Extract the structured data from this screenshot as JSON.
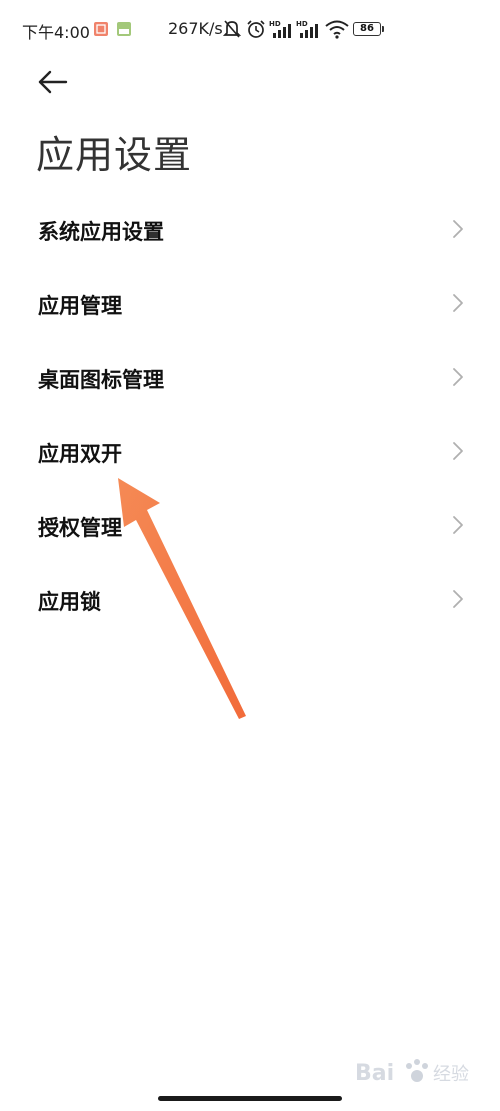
{
  "status_bar": {
    "time": "下午4:00",
    "network_speed": "267K/s",
    "battery": "86",
    "signal_label_1": "HD",
    "signal_label_2": "HD"
  },
  "header": {
    "title": "应用设置",
    "back_icon": "arrow-left-icon"
  },
  "menu": {
    "items": [
      {
        "label": "系统应用设置"
      },
      {
        "label": "应用管理"
      },
      {
        "label": "桌面图标管理"
      },
      {
        "label": "应用双开"
      },
      {
        "label": "授权管理"
      },
      {
        "label": "应用锁"
      }
    ]
  },
  "colors": {
    "annotation_arrow": "#f47c4b",
    "chevron": "#b0b0b0",
    "watermark": "#cfd4dc"
  }
}
